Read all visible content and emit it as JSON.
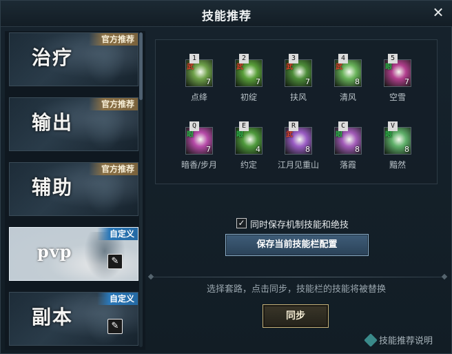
{
  "window": {
    "title": "技能推荐",
    "close_icon": "close-icon"
  },
  "presets": [
    {
      "name": "治疗",
      "tag": "官方推荐",
      "tag_type": "official",
      "editable": false,
      "active": false
    },
    {
      "name": "输出",
      "tag": "官方推荐",
      "tag_type": "official",
      "editable": false,
      "active": false
    },
    {
      "name": "辅助",
      "tag": "官方推荐",
      "tag_type": "official",
      "editable": false,
      "active": false
    },
    {
      "name": "pvp",
      "tag": "自定义",
      "tag_type": "custom",
      "editable": true,
      "active": true
    },
    {
      "name": "副本",
      "tag": "自定义",
      "tag_type": "custom",
      "editable": true,
      "active": false
    }
  ],
  "skills": [
    {
      "key": "1",
      "type": "武",
      "count": "7",
      "name": "点绛",
      "color": "#6fa24a"
    },
    {
      "key": "2",
      "type": "武",
      "count": "7",
      "name": "初绽",
      "color": "#5aa03a"
    },
    {
      "key": "3",
      "type": "武",
      "count": "7",
      "name": "扶风",
      "color": "#4e8e3a"
    },
    {
      "key": "4",
      "type": "武",
      "count": "8",
      "name": "清风",
      "color": "#69b35a"
    },
    {
      "key": "5",
      "type": "眼",
      "count": "7",
      "name": "空雪",
      "color": "#b23f8e"
    },
    {
      "key": "Q",
      "type": "眼",
      "count": "7",
      "name": "暗香/步月",
      "color": "#b64aa8"
    },
    {
      "key": "E",
      "type": "眼",
      "count": "4",
      "name": "约定",
      "color": "#4f9a3c"
    },
    {
      "key": "R",
      "type": "武",
      "count": "8",
      "name": "江月见重山",
      "color": "#9a5cc4"
    },
    {
      "key": "C",
      "type": "眼",
      "count": "8",
      "name": "落霞",
      "color": "#a25bb8"
    },
    {
      "key": "V",
      "type": "眼",
      "count": "8",
      "name": "黯然",
      "color": "#5fb06a"
    }
  ],
  "options": {
    "save_mechanics_label": "同时保存机制技能和绝技",
    "save_mechanics_checked": true,
    "check_mark": "✓"
  },
  "buttons": {
    "save_label": "保存当前技能栏配置",
    "sync_label": "同步",
    "edit_icon": "✎"
  },
  "hint": "选择套路，点击同步，技能栏的技能将被替换",
  "help_label": "技能推荐说明",
  "colors": {
    "type_wu": "#e0452e",
    "type_yan": "#2fb34a",
    "official_tag": "#8a7045",
    "custom_tag": "#2b78b8"
  }
}
